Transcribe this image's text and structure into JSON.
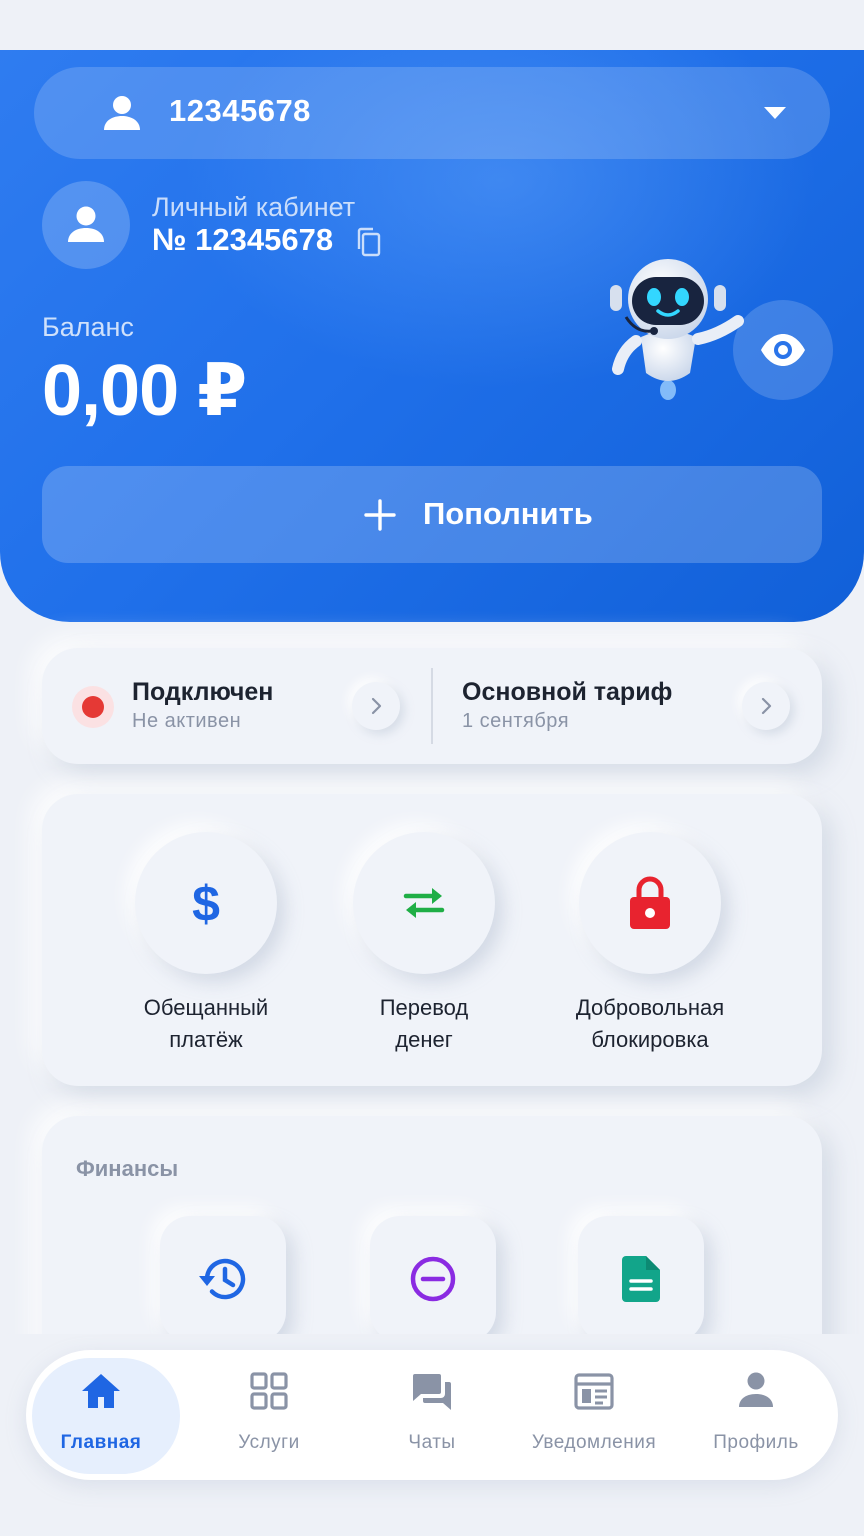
{
  "account_selector": {
    "number": "12345678"
  },
  "cabinet": {
    "label": "Личный кабинет",
    "number": "№ 12345678"
  },
  "balance": {
    "label": "Баланс",
    "value": "0,00 ₽"
  },
  "topup": {
    "label": "Пополнить"
  },
  "status": {
    "title": "Подключен",
    "subtitle": "Не активен"
  },
  "tariff": {
    "title": "Основной тариф",
    "subtitle": "1 сентября"
  },
  "actions": [
    {
      "label": "Обещанный\nплатёж",
      "icon": "dollar-icon",
      "color": "#1f66e3"
    },
    {
      "label": "Перевод\nденег",
      "icon": "transfer-arrows-icon",
      "color": "#1fae46"
    },
    {
      "label": "Добровольная\nблокировка",
      "icon": "lock-icon",
      "color": "#e8232f"
    }
  ],
  "finance": {
    "title": "Финансы",
    "tiles": [
      {
        "icon": "history-icon",
        "color": "#1f66e3"
      },
      {
        "icon": "minus-circle-icon",
        "color": "#8a2be2"
      },
      {
        "icon": "document-icon",
        "color": "#12a58a"
      }
    ]
  },
  "nav": {
    "items": [
      {
        "label": "Главная",
        "icon": "home-icon",
        "active": true
      },
      {
        "label": "Услуги",
        "icon": "grid-icon",
        "active": false
      },
      {
        "label": "Чаты",
        "icon": "chat-icon",
        "active": false
      },
      {
        "label": "Уведомления",
        "icon": "calendar-icon",
        "active": false
      },
      {
        "label": "Профиль",
        "icon": "person-icon",
        "active": false
      }
    ]
  },
  "colors": {
    "primary": "#1f66e3",
    "background": "#eef1f7",
    "status_red": "#e53935"
  }
}
